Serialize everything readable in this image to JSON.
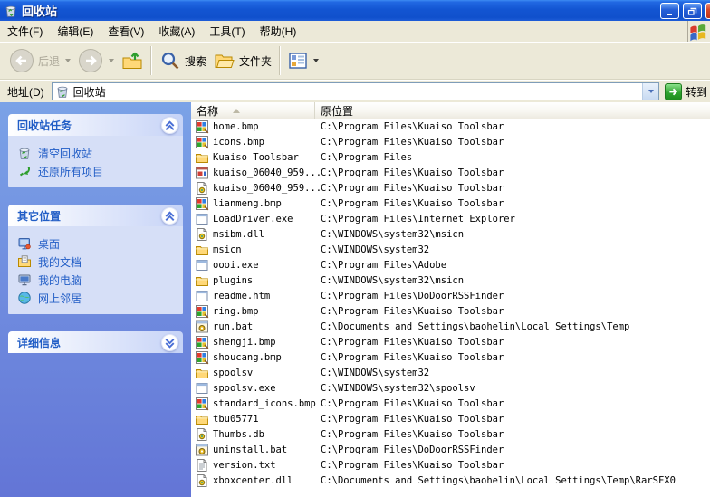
{
  "window": {
    "title": "回收站",
    "icon": "recycle-bin-icon",
    "controls": {
      "minimize": "minimize-icon",
      "restore": "restore-icon",
      "close": "close-icon"
    }
  },
  "menu": {
    "items": [
      {
        "label": "文件(F)"
      },
      {
        "label": "编辑(E)"
      },
      {
        "label": "查看(V)"
      },
      {
        "label": "收藏(A)"
      },
      {
        "label": "工具(T)"
      },
      {
        "label": "帮助(H)"
      }
    ]
  },
  "toolbar": {
    "back_label": "后退",
    "search_label": "搜索",
    "folders_label": "文件夹"
  },
  "address": {
    "label": "地址(D)",
    "value": "回收站",
    "icon": "recycle-bin-icon",
    "go_label": "转到"
  },
  "sidebar": {
    "panels": [
      {
        "title": "回收站任务",
        "collapsed": false,
        "items": [
          {
            "label": "清空回收站",
            "icon": "empty-recycle-bin-icon"
          },
          {
            "label": "还原所有项目",
            "icon": "restore-all-items-icon"
          }
        ]
      },
      {
        "title": "其它位置",
        "collapsed": false,
        "items": [
          {
            "label": "桌面",
            "icon": "desktop-icon"
          },
          {
            "label": "我的文档",
            "icon": "my-documents-icon"
          },
          {
            "label": "我的电脑",
            "icon": "my-computer-icon"
          },
          {
            "label": "网上邻居",
            "icon": "network-places-icon"
          }
        ]
      },
      {
        "title": "详细信息",
        "collapsed": true,
        "items": []
      }
    ]
  },
  "list": {
    "columns": [
      {
        "label": "名称",
        "sort": "ascending"
      },
      {
        "label": "原位置"
      }
    ],
    "files": [
      {
        "name": "home.bmp",
        "icon": "bmp-image-icon",
        "path": "C:\\Program Files\\Kuaiso Toolsbar"
      },
      {
        "name": "icons.bmp",
        "icon": "bmp-image-icon",
        "path": "C:\\Program Files\\Kuaiso Toolsbar"
      },
      {
        "name": "Kuaiso Toolsbar",
        "icon": "folder-icon",
        "path": "C:\\Program Files"
      },
      {
        "name": "kuaiso_06040_959...",
        "icon": "media-window-icon",
        "path": "C:\\Program Files\\Kuaiso Toolsbar"
      },
      {
        "name": "kuaiso_06040_959...",
        "icon": "dll-gear-icon",
        "path": "C:\\Program Files\\Kuaiso Toolsbar"
      },
      {
        "name": "lianmeng.bmp",
        "icon": "bmp-image-icon",
        "path": "C:\\Program Files\\Kuaiso Toolsbar"
      },
      {
        "name": "LoadDriver.exe",
        "icon": "app-window-icon",
        "path": "C:\\Program Files\\Internet Explorer"
      },
      {
        "name": "msibm.dll",
        "icon": "dll-gear-icon",
        "path": "C:\\WINDOWS\\system32\\msicn"
      },
      {
        "name": "msicn",
        "icon": "folder-icon",
        "path": "C:\\WINDOWS\\system32"
      },
      {
        "name": "oooi.exe",
        "icon": "app-window-icon",
        "path": "C:\\Program Files\\Adobe"
      },
      {
        "name": "plugins",
        "icon": "folder-icon",
        "path": "C:\\WINDOWS\\system32\\msicn"
      },
      {
        "name": "readme.htm",
        "icon": "app-window-icon",
        "path": "C:\\Program Files\\DoDoorRSSFinder"
      },
      {
        "name": "ring.bmp",
        "icon": "bmp-image-icon",
        "path": "C:\\Program Files\\Kuaiso Toolsbar"
      },
      {
        "name": "run.bat",
        "icon": "bat-gear-icon",
        "path": "C:\\Documents and Settings\\baohelin\\Local Settings\\Temp"
      },
      {
        "name": "shengji.bmp",
        "icon": "bmp-image-icon",
        "path": "C:\\Program Files\\Kuaiso Toolsbar"
      },
      {
        "name": "shoucang.bmp",
        "icon": "bmp-image-icon",
        "path": "C:\\Program Files\\Kuaiso Toolsbar"
      },
      {
        "name": "spoolsv",
        "icon": "folder-icon",
        "path": "C:\\WINDOWS\\system32"
      },
      {
        "name": "spoolsv.exe",
        "icon": "app-window-icon",
        "path": "C:\\WINDOWS\\system32\\spoolsv"
      },
      {
        "name": "standard_icons.bmp",
        "icon": "bmp-image-icon",
        "path": "C:\\Program Files\\Kuaiso Toolsbar"
      },
      {
        "name": "tbu05771",
        "icon": "folder-icon",
        "path": "C:\\Program Files\\Kuaiso Toolsbar"
      },
      {
        "name": "Thumbs.db",
        "icon": "dll-gear-icon",
        "path": "C:\\Program Files\\Kuaiso Toolsbar"
      },
      {
        "name": "uninstall.bat",
        "icon": "bat-gear-icon",
        "path": "C:\\Program Files\\DoDoorRSSFinder"
      },
      {
        "name": "version.txt",
        "icon": "txt-icon",
        "path": "C:\\Program Files\\Kuaiso Toolsbar"
      },
      {
        "name": "xboxcenter.dll",
        "icon": "dll-gear-icon",
        "path": "C:\\Documents and Settings\\baohelin\\Local Settings\\Temp\\RarSFX0"
      }
    ]
  },
  "colors": {
    "titlebar_blue": "#1355D2",
    "taskpane_top": "#7BA2E7",
    "taskpane_bottom": "#6375D6",
    "panel_title_blue": "#215DC6",
    "link_blue": "#215DC6",
    "go_green": "#2FA32F",
    "chrome_bg": "#ECE9D8"
  }
}
